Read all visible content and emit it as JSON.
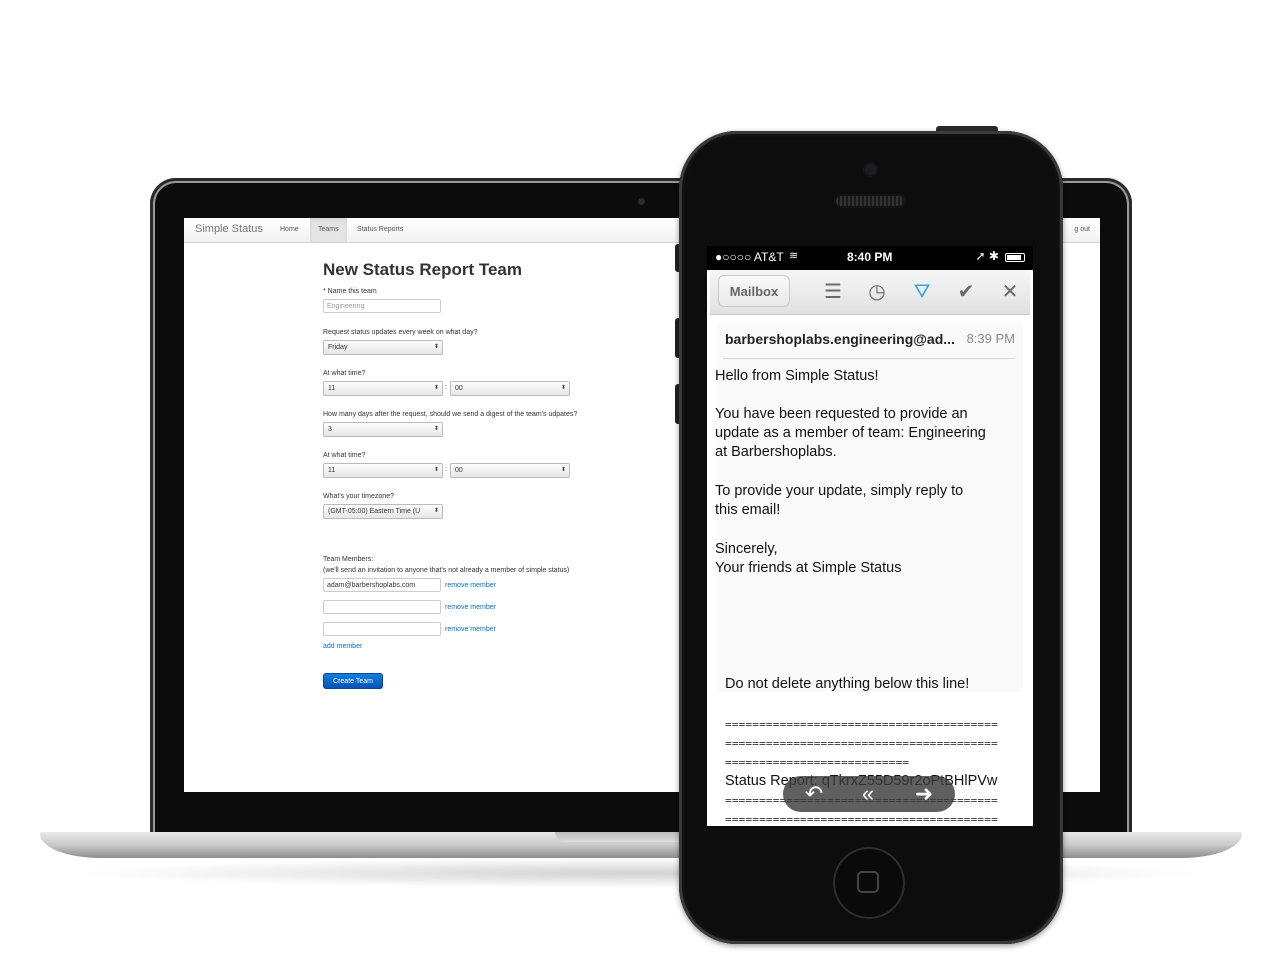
{
  "laptop": {
    "app": {
      "brand": "Simple Status",
      "nav": [
        "Home",
        "Teams",
        "Status Reports"
      ],
      "signout": "g out"
    },
    "form": {
      "title": "New Status Report Team",
      "name_label": "* Name this team",
      "name_placeholder": "Engineering",
      "day_label": "Request status updates every week on what day?",
      "day_value": "Friday",
      "time1_label": "At what time?",
      "time1_hour": "11",
      "time1_minute": "00",
      "digest_label": "How many days after the request, should we send a digest of the team's udpates?",
      "digest_value": "3",
      "time2_label": "At what time?",
      "time2_hour": "11",
      "time2_minute": "00",
      "tz_label": "What's your timezone?",
      "tz_value": "(GMT-05:00) Eastern Time (U",
      "members_label": "Team Members:",
      "members_note": "(we'll send an invitation to anyone that's not already a member of simple status)",
      "member1": "adam@barbershoplabs.com",
      "member2": "",
      "member3": "",
      "remove_label": "remove member",
      "add_label": "add member",
      "submit": "Create Team"
    }
  },
  "phone": {
    "status_bar": {
      "carrier": "●○○○○ AT&T",
      "time": "8:40 PM"
    },
    "toolbar": {
      "back": "Mailbox",
      "icons": [
        "list-icon",
        "clock-icon",
        "archive-tray-icon",
        "checkmark-icon",
        "close-icon"
      ]
    },
    "message": {
      "from": "barbershoplabs.engineering@ad...",
      "time": "8:39 PM",
      "greeting": "Hello from Simple Status!",
      "p1_l1": "You have been requested to provide an",
      "p1_l2": "update as a member of team: Engineering",
      "p1_l3": "at Barbershoplabs.",
      "p2_l1": "To provide your update, simply reply to",
      "p2_l2": "this email!",
      "sign_l1": "Sincerely,",
      "sign_l2": "Your friends at Simple Status",
      "warning": "Do not delete anything below this line!",
      "eq_line": "========================================",
      "eq_short": "===========================",
      "status_report": "Status Report: qTkrxZ55D59r2oPtBHlPVw"
    },
    "reply_bar_icons": [
      "reply-icon",
      "reply-all-icon",
      "forward-icon"
    ],
    "colors": {
      "accent": "#37a6d8",
      "primary_button": "#0a62c4",
      "link": "#0a6fc2"
    }
  }
}
